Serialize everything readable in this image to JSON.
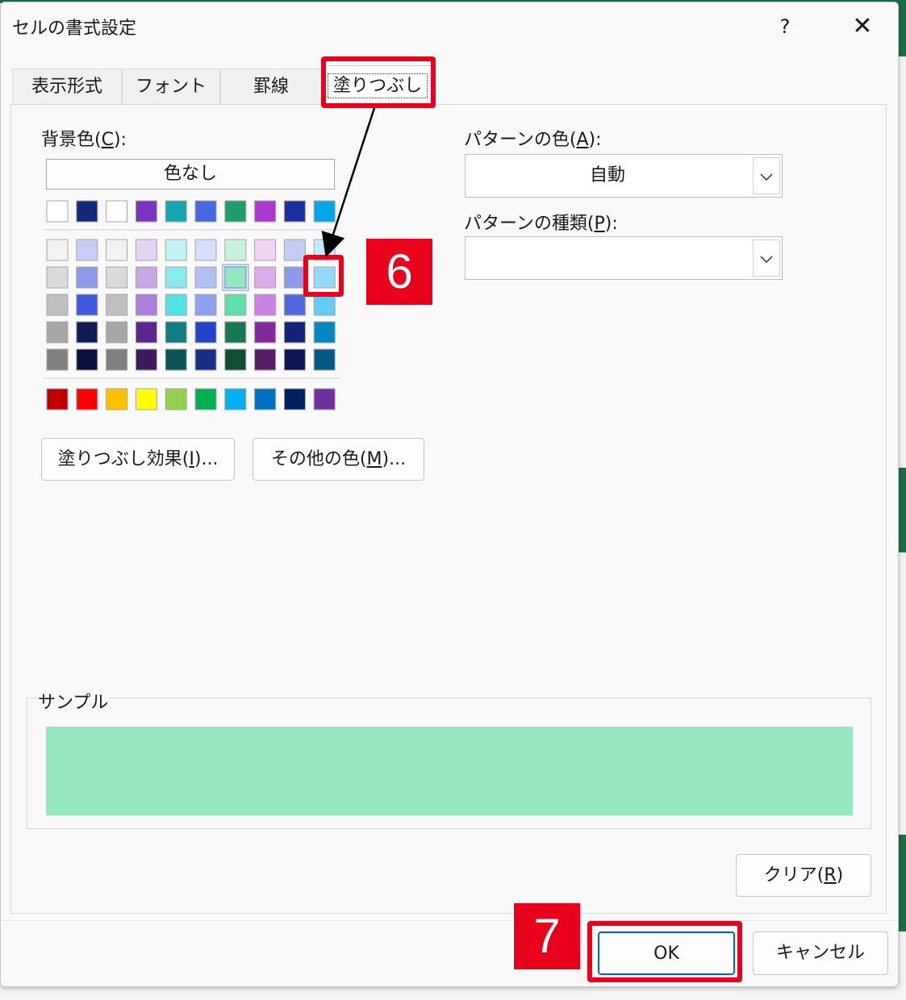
{
  "dialog": {
    "title": "セルの書式設定",
    "help_label": "?",
    "close_label": "✕"
  },
  "tabs": [
    {
      "label": "表示形式",
      "active": false
    },
    {
      "label": "フォント",
      "active": false
    },
    {
      "label": "罫線",
      "active": false
    },
    {
      "label": "塗りつぶし",
      "active": true
    }
  ],
  "background_color": {
    "label_prefix": "背景色(",
    "label_key": "C",
    "label_suffix": "):",
    "no_color_label": "色なし",
    "theme_top_row": [
      "#ffffff",
      "#14287c",
      "#ffffff",
      "#7a34c0",
      "#16a6b0",
      "#4469e0",
      "#1d9e6b",
      "#aa3acb",
      "#1a30a0",
      "#07a4ea"
    ],
    "tint_rows": [
      [
        "#f2f2f2",
        "#c7cdf4",
        "#f2f2f2",
        "#e3d3f3",
        "#c2f3f4",
        "#d7def9",
        "#c6f2dd",
        "#eed5f4",
        "#c5cbf3",
        "#c1ebfb"
      ],
      [
        "#d9d9d9",
        "#8d9aea",
        "#d9d9d9",
        "#c9a7e7",
        "#8aebee",
        "#b2c0f4",
        "#97e8c0",
        "#dcacea",
        "#8c9ae8",
        "#93dbf8"
      ],
      [
        "#bfbfbf",
        "#3f58e0",
        "#bfbfbf",
        "#ae7edc",
        "#53e2e7",
        "#8ea2ef",
        "#5ddeaa",
        "#cb83e0",
        "#5368de",
        "#62ccf5"
      ],
      [
        "#a6a6a6",
        "#0f1a57",
        "#a6a6a6",
        "#5b2690",
        "#107d84",
        "#2344c8",
        "#167750",
        "#822b98",
        "#132478",
        "#0886bf"
      ],
      [
        "#808080",
        "#0a1138",
        "#808080",
        "#3d1960",
        "#0a5358",
        "#182e86",
        "#0f4f35",
        "#561d65",
        "#0d1850",
        "#055980"
      ]
    ],
    "standard_row": [
      "#c00000",
      "#ff0000",
      "#ffc000",
      "#ffff00",
      "#92d050",
      "#00b050",
      "#00b0f0",
      "#0070c0",
      "#002060",
      "#7030a0"
    ],
    "selected_swatch": "row 2, col 6 (#97e8c0)"
  },
  "buttons": {
    "fill_effects": {
      "prefix": "塗りつぶし効果(",
      "key": "I",
      "suffix": ")..."
    },
    "more_colors": {
      "prefix": "その他の色(",
      "key": "M",
      "suffix": ")..."
    },
    "clear": {
      "prefix": "クリア(",
      "key": "R",
      "suffix": ")"
    },
    "ok": "OK",
    "cancel": "キャンセル"
  },
  "pattern_color": {
    "label_prefix": "パターンの色(",
    "label_key": "A",
    "label_suffix": "):",
    "value": "自動"
  },
  "pattern_style": {
    "label_prefix": "パターンの種類(",
    "label_key": "P",
    "label_suffix": "):",
    "value": ""
  },
  "sample": {
    "label": "サンプル",
    "color": "#97e8c0"
  },
  "annotations": {
    "step6": "6",
    "step7": "7",
    "highlight_color": "#e8001c"
  }
}
